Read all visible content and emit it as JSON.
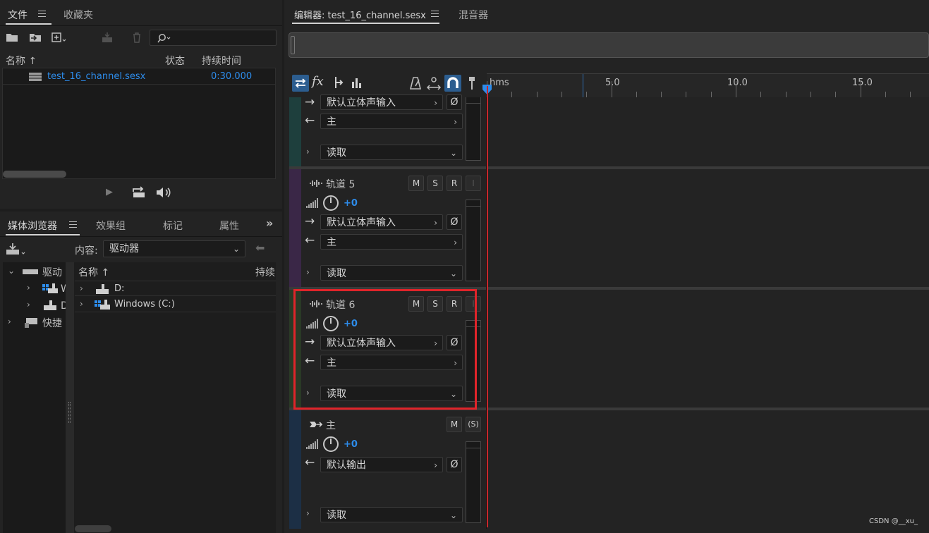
{
  "files_panel": {
    "tabs": [
      "文件",
      "收藏夹"
    ],
    "search_placeholder": "",
    "columns": {
      "name": "名称 ↑",
      "status": "状态",
      "duration": "持续时间"
    },
    "rows": [
      {
        "name": "test_16_channel.sesx",
        "duration": "0:30.000"
      }
    ]
  },
  "media_panel": {
    "tabs": [
      "媒体浏览器",
      "效果组",
      "标记",
      "属性"
    ],
    "content_label": "内容:",
    "content_value": "驱动器",
    "tree": [
      "驱动",
      "W",
      "D",
      "快捷"
    ],
    "columns": {
      "name": "名称 ↑",
      "duration": "持续"
    },
    "rows": [
      "D:",
      "Windows (C:)"
    ]
  },
  "editor": {
    "tabs": [
      "编辑器: test_16_channel.sesx",
      "混音器"
    ],
    "ruler": {
      "unit": "hms",
      "labels": [
        "5.0",
        "10.0",
        "15.0"
      ]
    },
    "tracks": [
      {
        "name": "",
        "input": "默认立体声输入",
        "output": "主",
        "mode": "读取"
      },
      {
        "name": "轨道 5",
        "volume": "+0",
        "input": "默认立体声输入",
        "output": "主",
        "mode": "读取"
      },
      {
        "name": "轨道 6",
        "volume": "+0",
        "input": "默认立体声输入",
        "output": "主",
        "mode": "读取"
      },
      {
        "name": "主",
        "volume": "+0",
        "output": "默认输出",
        "mode": "读取"
      }
    ],
    "buttons": {
      "mute": "M",
      "solo": "S",
      "record": "R",
      "input_monitor": "I",
      "solo_safe": "(S)"
    },
    "phase_symbol": "Ø"
  },
  "watermark": "CSDN @__xu_",
  "colors": {
    "accent_blue": "#2d8ceb",
    "highlight_red": "#e0242a",
    "playhead_red": "#c8272b",
    "track_strip_teal": "#1e3f3d",
    "track_strip_purple": "#3a2747",
    "track_strip_green": "#2a3a26",
    "track_strip_blue": "#1c2f45"
  }
}
